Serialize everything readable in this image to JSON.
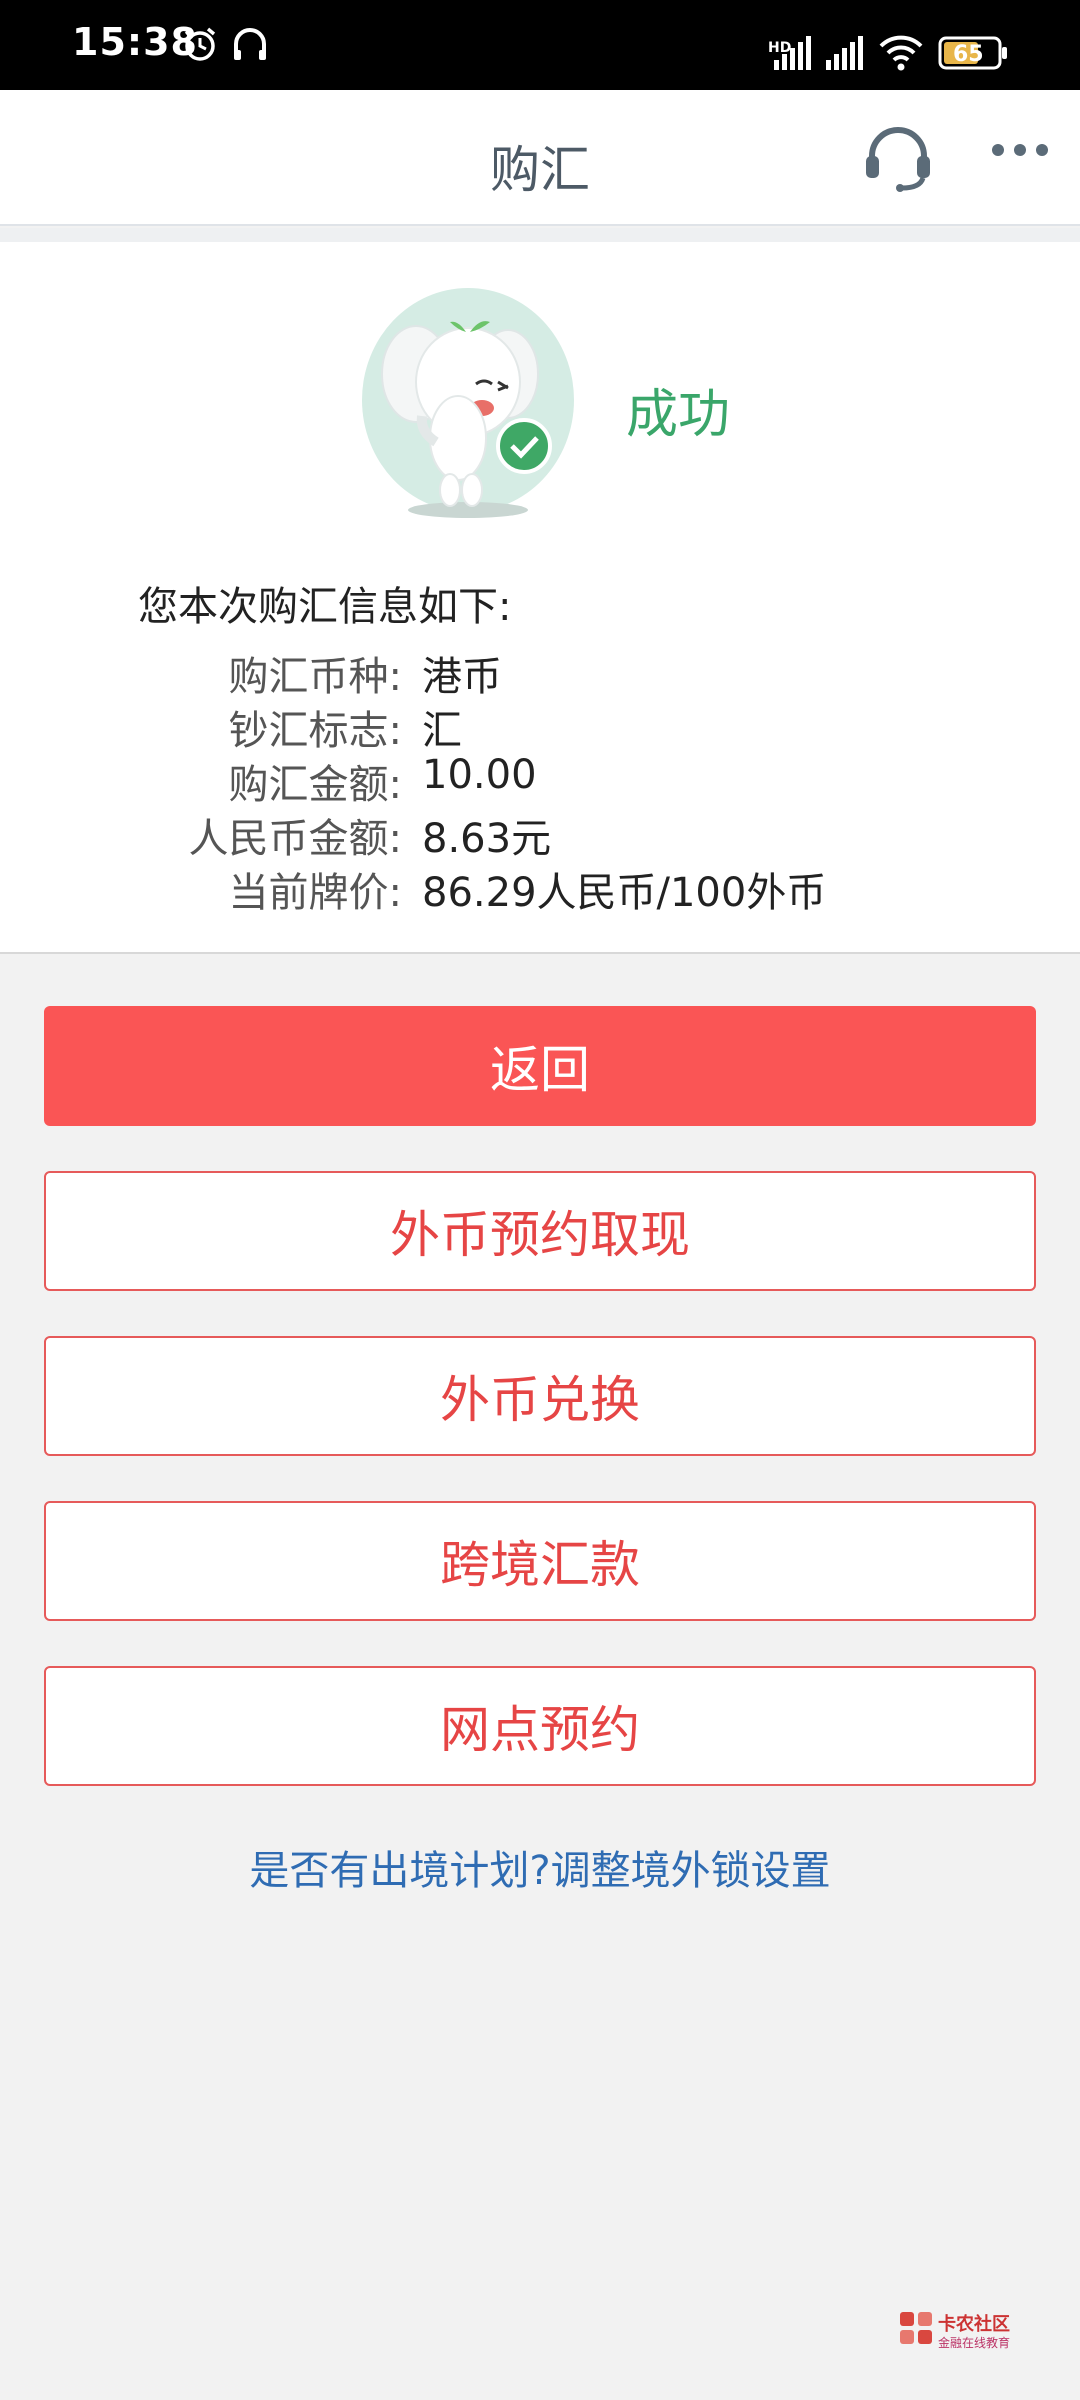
{
  "status_bar": {
    "time": "15:38",
    "battery": "65",
    "network_hd": "HD"
  },
  "header": {
    "title": "购汇",
    "service_icon": "headset-icon",
    "more_icon": "more-icon"
  },
  "result": {
    "status": "成功",
    "intro": "您本次购汇信息如下:",
    "rows": [
      {
        "label": "购汇币种:",
        "value": "港币"
      },
      {
        "label": "钞汇标志:",
        "value": "汇"
      },
      {
        "label": "购汇金额:",
        "value": "10.00"
      },
      {
        "label": "人民币金额:",
        "value": "8.63元"
      },
      {
        "label": "当前牌价:",
        "value": "86.29人民币/100外币"
      }
    ]
  },
  "buttons": {
    "back": "返回",
    "withdraw": "外币预约取现",
    "exchange": "外币兑换",
    "remittance": "跨境汇款",
    "branch": "网点预约"
  },
  "link": "是否有出境计划?调整境外锁设置",
  "watermark": {
    "name": "卡农社区",
    "sub": "金融在线教育"
  },
  "colors": {
    "primary": "#fa5555",
    "success": "#3aa66a",
    "link": "#2f6cb3"
  }
}
